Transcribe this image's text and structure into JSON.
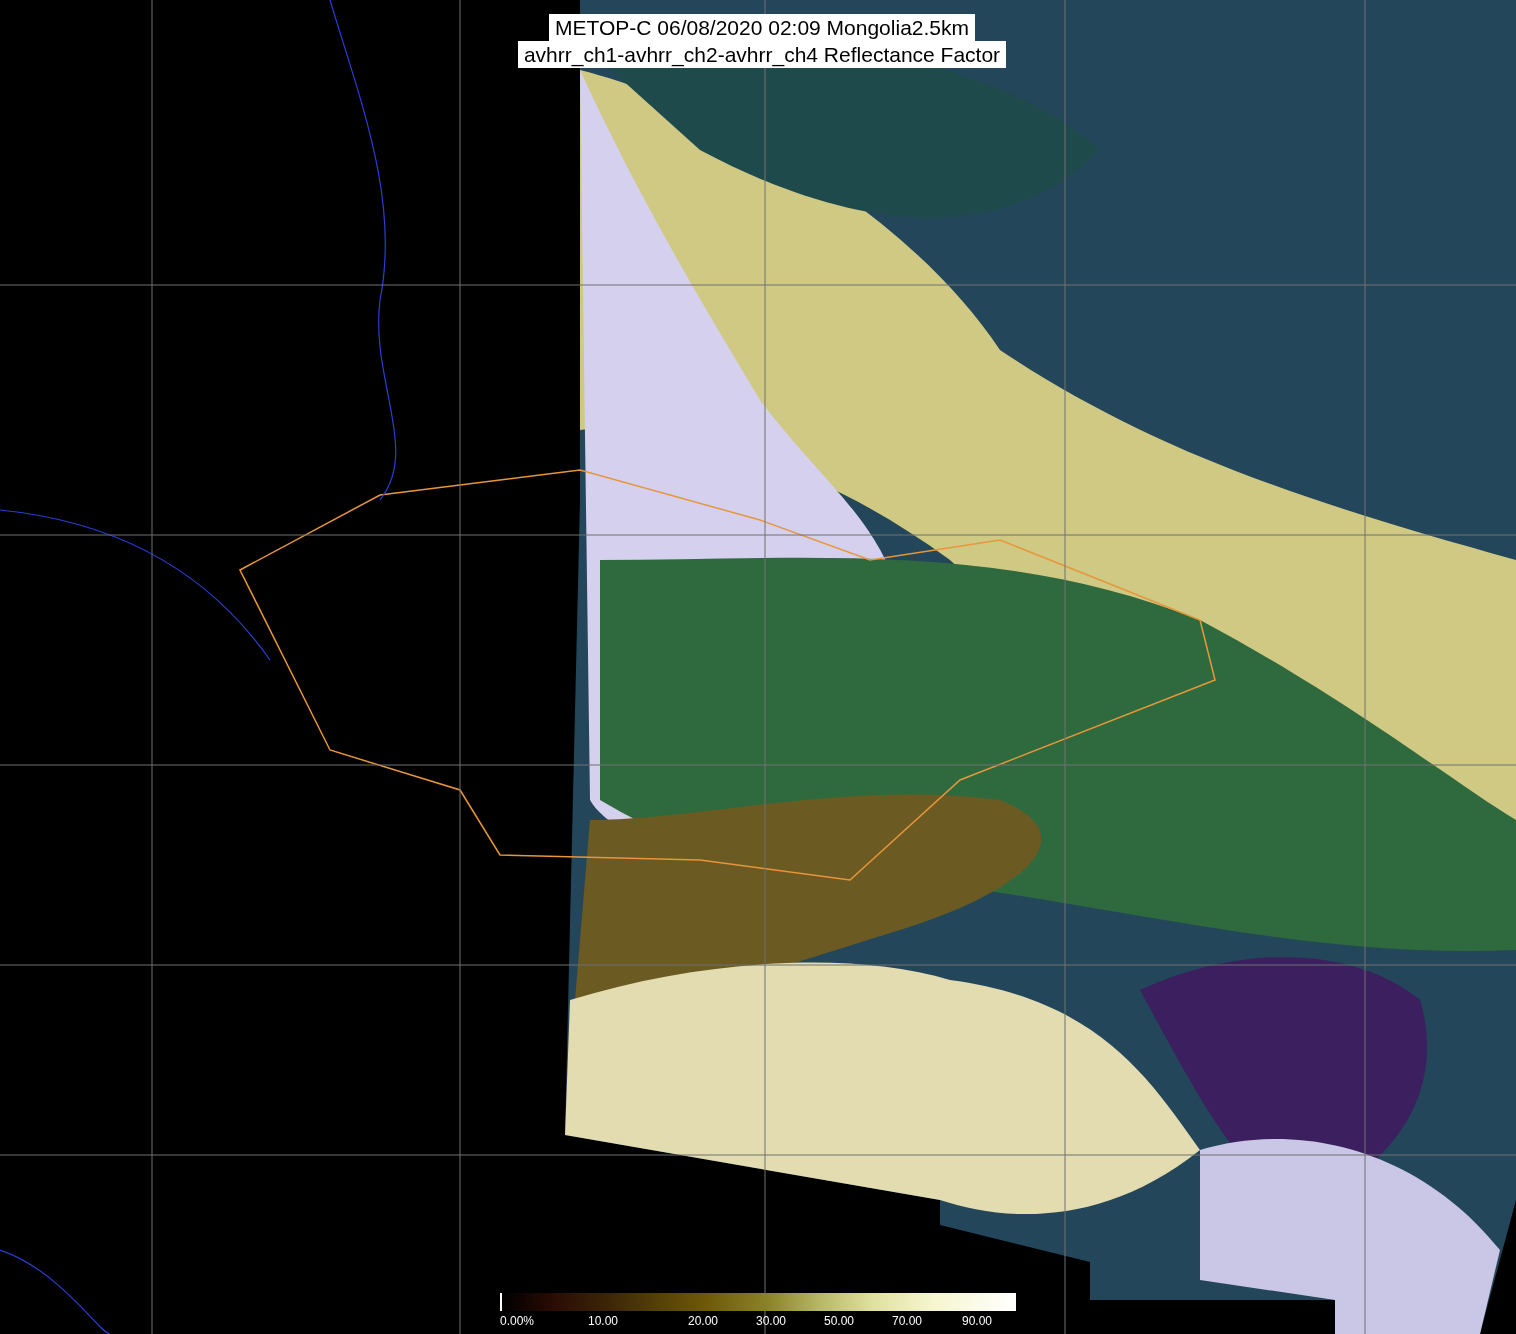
{
  "title": {
    "lines": [
      "METOP-C 06/08/2020 02:09 Mongolia2.5km",
      "avhrr_ch1-avhrr_ch2-avhrr_ch4 Reflectance Factor"
    ]
  },
  "colorbar": {
    "labels": [
      "0.00%",
      "10.00",
      "20.00",
      "30.00",
      "50.00",
      "70.00",
      "90.00"
    ]
  }
}
